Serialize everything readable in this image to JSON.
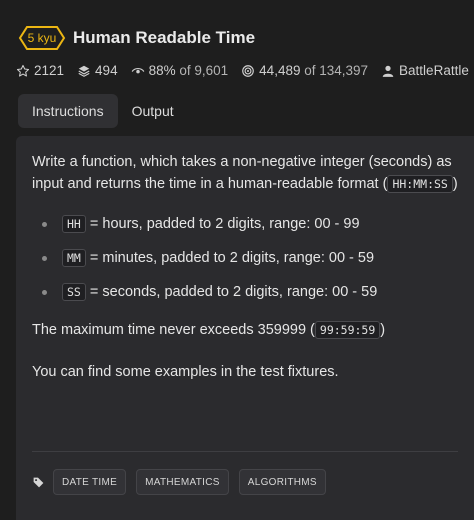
{
  "header": {
    "rank": "5 kyu",
    "rank_color": "#ecb613",
    "title": "Human Readable Time"
  },
  "stats": {
    "stars": "2121",
    "collections": "494",
    "satisfaction_percent": "88%",
    "satisfaction_of": "of 9,601",
    "completed": "44,489",
    "completed_of": "of 134,397",
    "author": "BattleRattle"
  },
  "tabs": [
    {
      "label": "Instructions",
      "active": true
    },
    {
      "label": "Output",
      "active": false
    }
  ],
  "description": {
    "intro": "Write a function, which takes a non-negative integer (seconds) as input and returns the time in a human-readable format (",
    "format_code": "HH:MM:SS",
    "intro_end": ")",
    "definitions": [
      {
        "code": "HH",
        "text": "= hours, padded to 2 digits, range: 00 - 99"
      },
      {
        "code": "MM",
        "text": "= minutes, padded to 2 digits, range: 00 - 59"
      },
      {
        "code": "SS",
        "text": "= seconds, padded to 2 digits, range: 00 - 59"
      }
    ],
    "max_text": "The maximum time never exceeds 359999 (",
    "max_code": "99:59:59",
    "max_end": ")",
    "examples_text": "You can find some examples in the test fixtures."
  },
  "tags": [
    "DATE TIME",
    "MATHEMATICS",
    "ALGORITHMS"
  ],
  "icons": {
    "star": "star-icon",
    "collections": "layers-icon",
    "satisfaction": "eye-icon",
    "completed": "target-icon",
    "author": "user-icon",
    "tag": "tag-icon"
  }
}
